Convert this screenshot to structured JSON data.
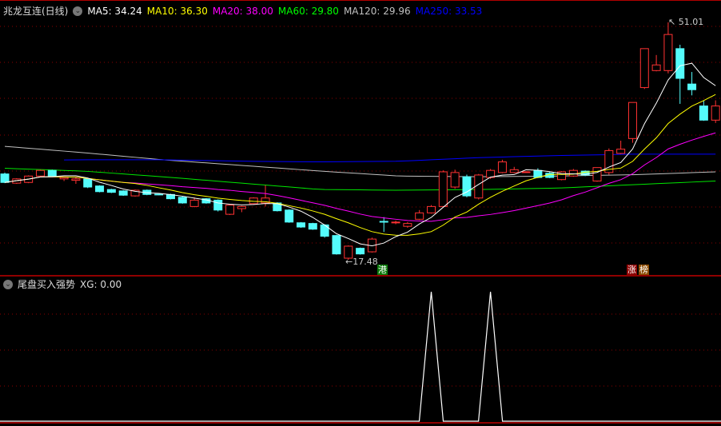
{
  "header": {
    "stock_name": "兆龙互连(日线)",
    "ma5": "MA5: 34.24",
    "ma10": "MA10: 36.30",
    "ma20": "MA20: 38.00",
    "ma60": "MA60: 29.80",
    "ma120": "MA120: 29.96",
    "ma250": "MA250: 33.53"
  },
  "colors": {
    "up": "#ff3232",
    "down": "#54fcfc",
    "ma5": "#ffffff",
    "ma10": "#ffff00",
    "ma20": "#ff00ff",
    "ma60": "#00e600",
    "ma120": "#c0c0c0",
    "ma250": "#0000ff",
    "grid": "#8b0000"
  },
  "annotations": {
    "high_label": "51.01",
    "low_label": "17.48",
    "badge_hk": "港",
    "badge_zhang": "涨",
    "badge_bang": "榜"
  },
  "indicator": {
    "title": "尾盘买入强势",
    "xg": "XG: 0.00",
    "signals": [
      36,
      41
    ]
  },
  "chart_data": {
    "type": "candlestick",
    "price_range": [
      17.48,
      51.01
    ],
    "candles": [
      [
        29.6,
        29.8,
        28.3,
        28.4
      ],
      [
        28.3,
        29.0,
        28.2,
        28.9
      ],
      [
        28.4,
        29.4,
        28.3,
        29.3
      ],
      [
        29.3,
        30.2,
        29.2,
        30.1
      ],
      [
        30.1,
        30.2,
        29.2,
        29.3
      ],
      [
        28.9,
        29.2,
        28.6,
        29.1
      ],
      [
        28.7,
        29.1,
        28.2,
        28.9
      ],
      [
        28.9,
        29.0,
        27.6,
        27.75
      ],
      [
        27.9,
        28.0,
        27.0,
        27.1
      ],
      [
        27.4,
        27.5,
        26.9,
        27.0
      ],
      [
        27.2,
        27.3,
        26.5,
        26.6
      ],
      [
        26.5,
        27.4,
        26.4,
        27.3
      ],
      [
        27.3,
        27.4,
        26.6,
        26.7
      ],
      [
        26.75,
        26.8,
        26.6,
        26.7
      ],
      [
        26.7,
        26.8,
        26.0,
        26.1
      ],
      [
        26.3,
        26.4,
        25.4,
        25.5
      ],
      [
        25.0,
        26.3,
        24.9,
        25.9
      ],
      [
        26.1,
        26.2,
        25.4,
        25.5
      ],
      [
        25.9,
        26.0,
        24.3,
        24.5
      ],
      [
        23.9,
        25.3,
        23.8,
        25.2
      ],
      [
        24.7,
        25.1,
        24.2,
        25.0
      ],
      [
        25.4,
        26.3,
        25.3,
        26.2
      ],
      [
        25.5,
        28.0,
        25.0,
        26.2
      ],
      [
        25.5,
        25.6,
        24.3,
        24.4
      ],
      [
        24.5,
        24.6,
        22.7,
        22.8
      ],
      [
        22.7,
        22.8,
        22.0,
        22.1
      ],
      [
        22.6,
        22.7,
        21.7,
        21.8
      ],
      [
        22.4,
        22.5,
        20.6,
        20.8
      ],
      [
        20.9,
        21.0,
        18.2,
        18.3
      ],
      [
        17.7,
        19.5,
        17.48,
        19.4
      ],
      [
        19.1,
        19.2,
        18.2,
        18.3
      ],
      [
        18.6,
        20.6,
        18.5,
        20.4
      ],
      [
        22.9,
        23.5,
        21.4,
        22.8
      ],
      [
        22.8,
        23.0,
        22.5,
        22.8
      ],
      [
        22.2,
        22.8,
        22.0,
        22.6
      ],
      [
        23.2,
        24.5,
        23.1,
        24.1
      ],
      [
        24.1,
        25.2,
        24.0,
        25.0
      ],
      [
        25.0,
        30.1,
        24.9,
        29.9
      ],
      [
        27.75,
        30.2,
        27.5,
        29.8
      ],
      [
        29.2,
        29.5,
        26.3,
        26.5
      ],
      [
        26.2,
        29.6,
        26.0,
        29.45
      ],
      [
        29.1,
        30.3,
        28.9,
        30.1
      ],
      [
        29.8,
        31.6,
        29.7,
        31.3
      ],
      [
        29.8,
        30.6,
        29.7,
        30.2
      ],
      [
        29.9,
        30.0,
        29.8,
        29.9
      ],
      [
        30.1,
        30.4,
        29.0,
        29.1
      ],
      [
        29.7,
        29.9,
        29.0,
        29.1
      ],
      [
        28.8,
        30.0,
        28.7,
        29.9
      ],
      [
        29.3,
        30.3,
        29.2,
        30.1
      ],
      [
        30.0,
        30.1,
        29.3,
        29.45
      ],
      [
        28.6,
        30.5,
        28.5,
        30.5
      ],
      [
        29.8,
        33.2,
        29.5,
        32.9
      ],
      [
        32.5,
        34.3,
        32.4,
        33.1
      ],
      [
        34.6,
        39.7,
        34.0,
        39.7
      ],
      [
        41.8,
        47.3,
        41.6,
        47.3
      ],
      [
        44.2,
        46.4,
        44.1,
        45.0
      ],
      [
        44.2,
        51.01,
        43.8,
        49.3
      ],
      [
        47.3,
        47.85,
        39.5,
        43.1
      ],
      [
        42.3,
        44.0,
        40.7,
        41.5
      ],
      [
        39.2,
        40.0,
        37.1,
        37.2
      ],
      [
        37.2,
        40.0,
        36.8,
        39.2
      ]
    ],
    "ma60_samples": [
      30.4,
      30.0,
      29.2,
      28.3,
      27.4,
      27.3,
      27.4,
      27.6,
      28.1,
      28.6
    ],
    "ma120_samples": [
      33.5,
      32.6,
      31.6,
      30.8,
      30.0,
      29.3,
      29.2,
      29.3,
      29.5,
      29.9
    ],
    "ma250_samples": [
      31.5,
      31.6,
      31.6,
      31.4,
      31.3,
      31.4,
      31.9,
      32.2,
      32.4,
      32.4
    ]
  }
}
